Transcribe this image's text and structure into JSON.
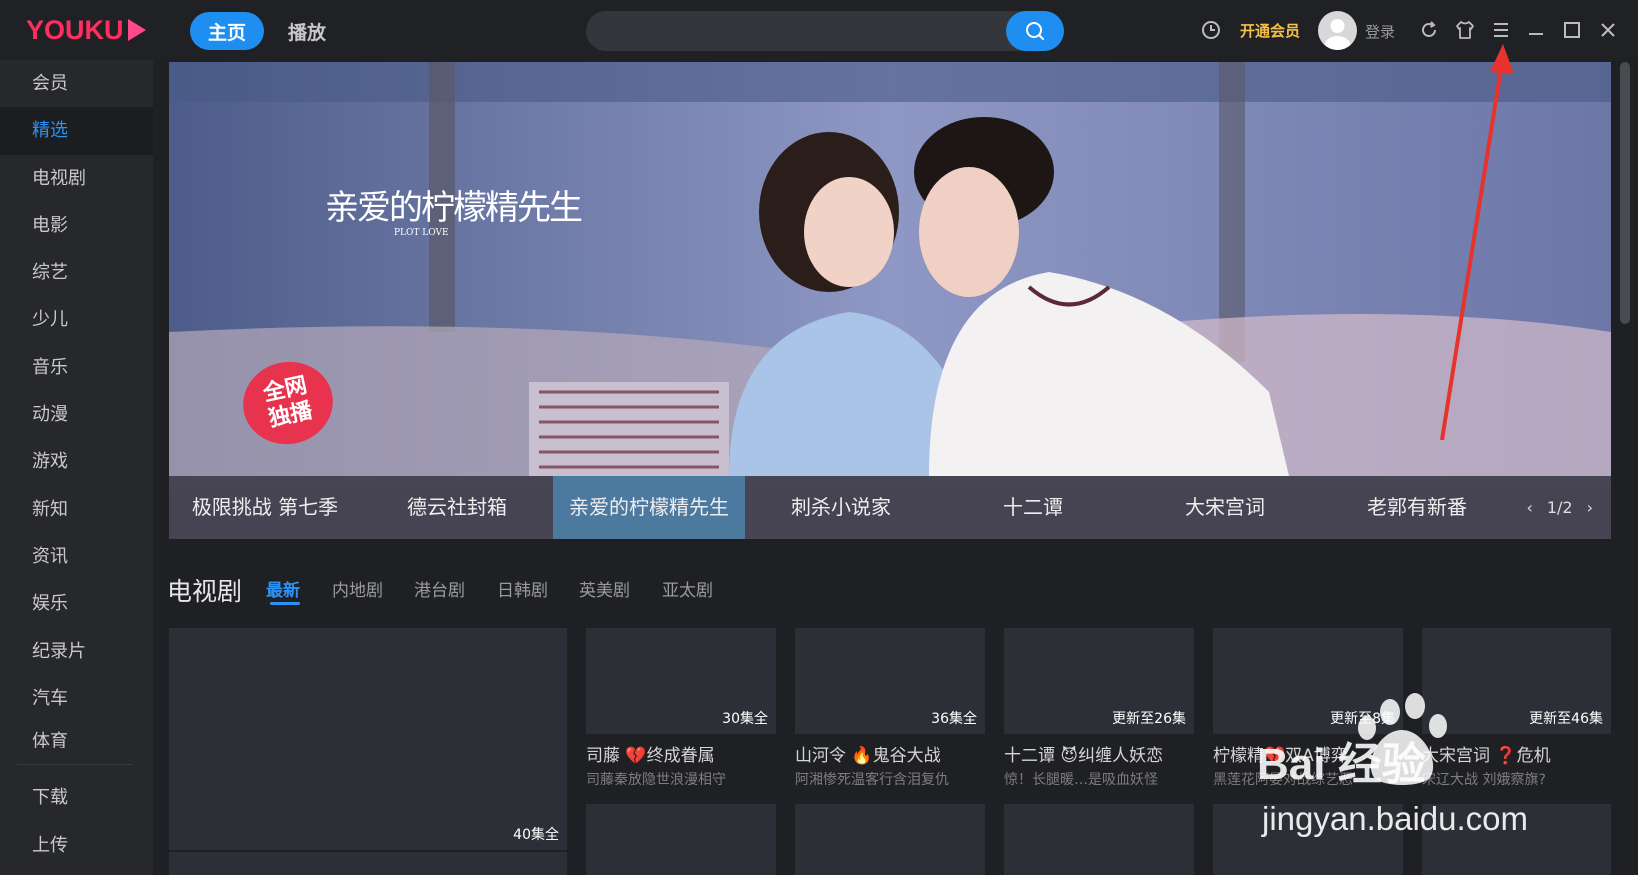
{
  "app": {
    "logo_text": "YOUKU",
    "nav": {
      "home": "主页",
      "play": "播放"
    },
    "search": {
      "placeholder": ""
    },
    "vip_label": "开通会员",
    "login_label": "登录",
    "colors": {
      "accent": "#1e8ef0",
      "brand": "#ff2e5f",
      "vip": "#f5c04a"
    }
  },
  "sidebar": {
    "items": [
      {
        "label": "会员"
      },
      {
        "label": "精选",
        "active": true
      },
      {
        "label": "电视剧"
      },
      {
        "label": "电影"
      },
      {
        "label": "综艺"
      },
      {
        "label": "少儿"
      },
      {
        "label": "音乐"
      },
      {
        "label": "动漫"
      },
      {
        "label": "游戏"
      },
      {
        "label": "新知"
      },
      {
        "label": "资讯"
      },
      {
        "label": "娱乐"
      },
      {
        "label": "纪录片"
      },
      {
        "label": "汽车"
      },
      {
        "label": "体育"
      }
    ],
    "bottom": [
      {
        "label": "下载"
      },
      {
        "label": "上传"
      }
    ]
  },
  "banner": {
    "poster_title": "亲爱的柠檬精先生",
    "poster_subtitle": "PLOT LOVE",
    "badge_line1": "全网",
    "badge_line2": "独播",
    "tabs": [
      {
        "label": "极限挑战 第七季"
      },
      {
        "label": "德云社封箱"
      },
      {
        "label": "亲爱的柠檬精先生",
        "active": true
      },
      {
        "label": "刺杀小说家"
      },
      {
        "label": "十二谭"
      },
      {
        "label": "大宋宫词"
      },
      {
        "label": "老郭有新番"
      }
    ],
    "pager": "1/2"
  },
  "section": {
    "title": "电视剧",
    "tabs": [
      {
        "label": "最新",
        "active": true
      },
      {
        "label": "内地剧"
      },
      {
        "label": "港台剧"
      },
      {
        "label": "日韩剧"
      },
      {
        "label": "英美剧"
      },
      {
        "label": "亚太剧"
      }
    ],
    "big_card": {
      "episodes": "40集全"
    },
    "cards": [
      {
        "episodes": "30集全",
        "title": "司藤 💔终成眷属",
        "subtitle": "司藤秦放隐世浪漫相守"
      },
      {
        "episodes": "36集全",
        "title": "山河令 🔥鬼谷大战",
        "subtitle": "阿湘惨死温客行含泪复仇"
      },
      {
        "episodes": "更新至26集",
        "title": "十二谭 😈纠缠人妖恋",
        "subtitle": "惊！长腿暖…是吸血妖怪"
      },
      {
        "episodes": "更新至8集",
        "title": "柠檬精💔双A博弈",
        "subtitle": "黑莲花阿晏对战综艺恶"
      },
      {
        "episodes": "更新至46集",
        "title": "大宋宫词 ❓危机",
        "subtitle": "宋辽大战 刘娥察旗?"
      }
    ]
  },
  "watermark": {
    "brand": "Bai 经验",
    "url": "jingyan.baidu.com"
  }
}
